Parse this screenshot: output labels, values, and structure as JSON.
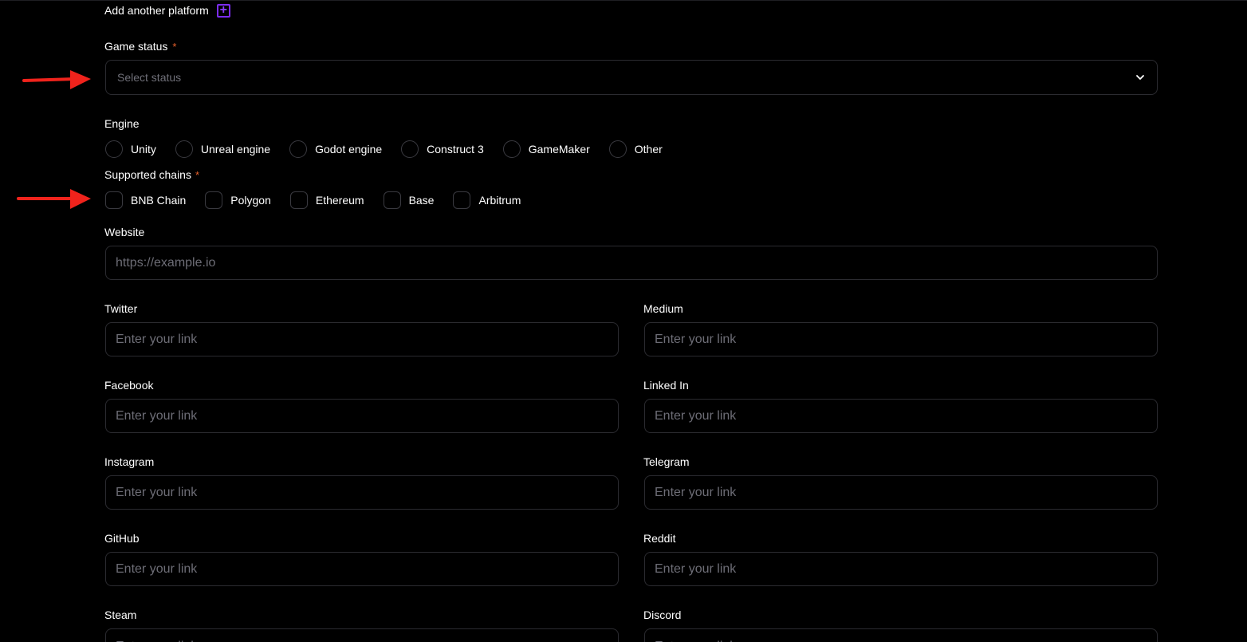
{
  "add_platform": {
    "label": "Add another platform",
    "icon": "plus-icon",
    "accent": "#7b2cf0"
  },
  "game_status": {
    "label": "Game status",
    "required_mark": "*",
    "placeholder": "Select status",
    "icon": "chevron-down-icon"
  },
  "engine": {
    "label": "Engine",
    "options": [
      "Unity",
      "Unreal engine",
      "Godot engine",
      "Construct 3",
      "GameMaker",
      "Other"
    ]
  },
  "chains": {
    "label": "Supported chains",
    "required_mark": "*",
    "options": [
      "BNB Chain",
      "Polygon",
      "Ethereum",
      "Base",
      "Arbitrum"
    ]
  },
  "website": {
    "label": "Website",
    "placeholder": "https://example.io"
  },
  "links": {
    "twitter": {
      "label": "Twitter",
      "placeholder": "Enter your link"
    },
    "medium": {
      "label": "Medium",
      "placeholder": "Enter your link"
    },
    "facebook": {
      "label": "Facebook",
      "placeholder": "Enter your link"
    },
    "linkedin": {
      "label": "Linked In",
      "placeholder": "Enter your link"
    },
    "instagram": {
      "label": "Instagram",
      "placeholder": "Enter your link"
    },
    "telegram": {
      "label": "Telegram",
      "placeholder": "Enter your link"
    },
    "github": {
      "label": "GitHub",
      "placeholder": "Enter your link"
    },
    "reddit": {
      "label": "Reddit",
      "placeholder": "Enter your link"
    },
    "steam": {
      "label": "Steam",
      "placeholder": "Enter your link"
    },
    "discord": {
      "label": "Discord",
      "placeholder": "Enter your link"
    }
  },
  "colors": {
    "required": "#e8612c",
    "annotation_arrow": "#f0231c",
    "border": "#2b2b30"
  }
}
